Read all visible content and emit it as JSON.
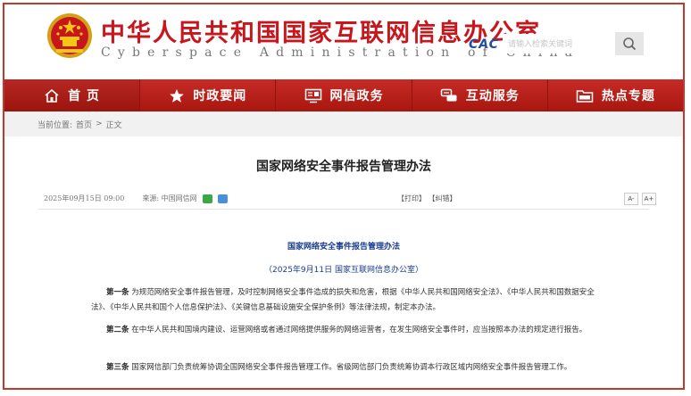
{
  "header": {
    "title": "中华人民共和国国家互联网信息办公室",
    "subtitle": "Cyberspace Administration of China",
    "cac_logo": "CAC",
    "search_placeholder": "请输入检索关键词",
    "brand_color": "#c8161d"
  },
  "nav": {
    "items": [
      {
        "label": "首 页",
        "icon": "home-icon"
      },
      {
        "label": "时政要闻",
        "icon": "star-icon"
      },
      {
        "label": "网信政务",
        "icon": "monitor-icon"
      },
      {
        "label": "互动服务",
        "icon": "interaction-icon"
      },
      {
        "label": "热点专题",
        "icon": "folder-icon"
      }
    ],
    "color": "#b81f1f"
  },
  "breadcrumb": {
    "prefix": "当前位置:",
    "home": "首页",
    "sep": ">",
    "current": "正文"
  },
  "article": {
    "title": "国家网络安全事件报告管理办法",
    "date": "2025年09月15日 09:00",
    "source": "来源: 中国网信网",
    "print": "【打印】",
    "error": "【纠错】",
    "font_small": "A-",
    "font_large": "A+"
  },
  "document": {
    "title": "国家网络安全事件报告管理办法",
    "subtitle": "（2025年9月11日 国家互联网信息办公室）",
    "paragraphs": [
      {
        "lead": "第一条",
        "text": "为规范网络安全事件报告管理，及时控制网络安全事件造成的损失和危害，根据《中华人民共和国网络安全法》、《中华人民共和国数据安全法》、《中华人民共和国个人信息保护法》、《关键信息基础设施安全保护条例》等法律法规，制定本办法。"
      },
      {
        "lead": "第二条",
        "text": "在中华人民共和国境内建设、运营网络或者通过网络提供服务的网络运营者，在发生网络安全事件时，应当按照本办法的规定进行报告。"
      },
      {
        "lead": "第三条",
        "text": "国家网信部门负责统筹协调全国网络安全事件报告管理工作。省级网信部门负责统筹协调本行政区域内网络安全事件报告管理工作。"
      }
    ]
  }
}
